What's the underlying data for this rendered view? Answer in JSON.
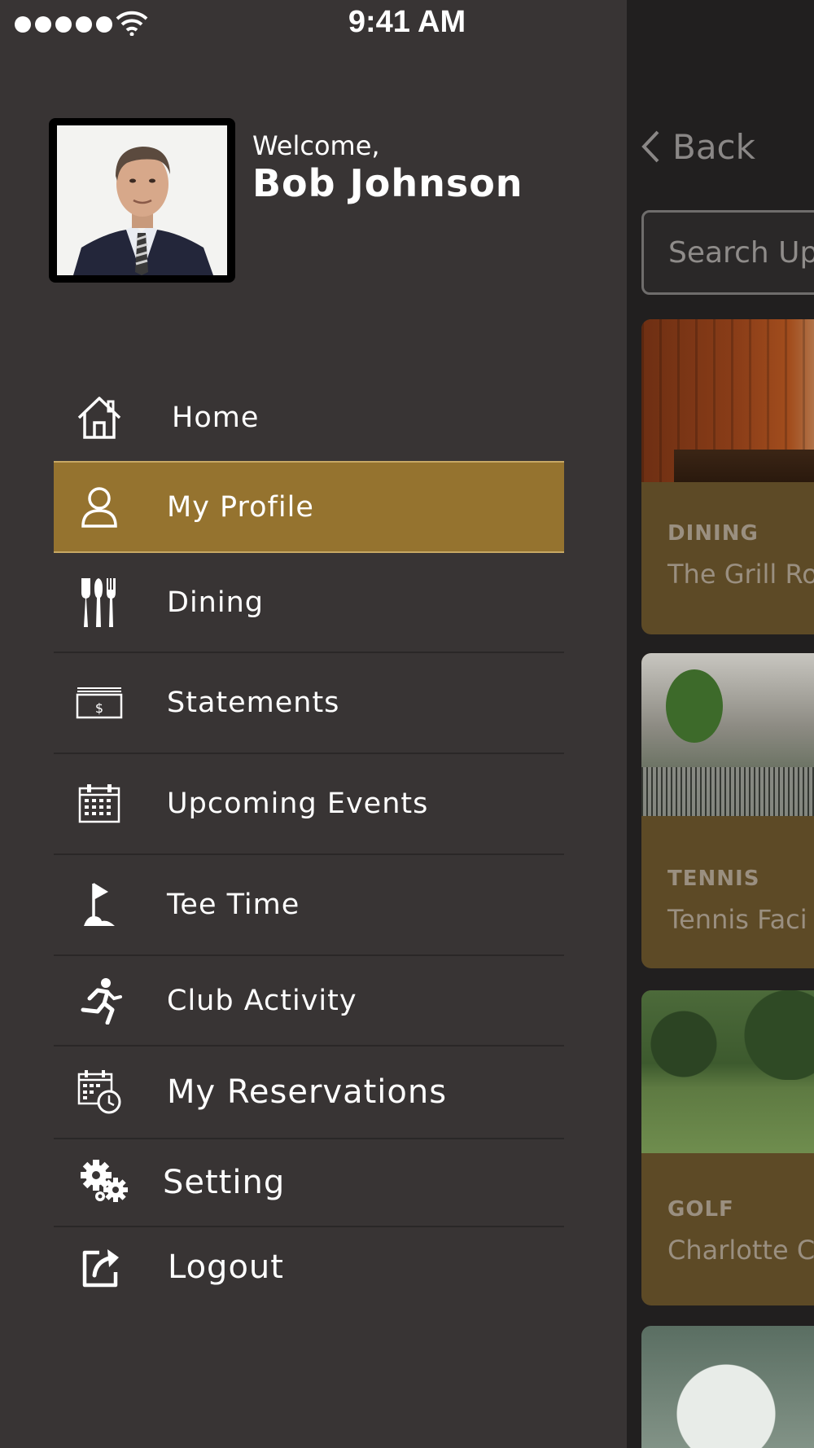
{
  "status_bar": {
    "time": "9:41 AM"
  },
  "background_screen": {
    "back_label": "Back",
    "search_placeholder": "Search Up",
    "cards": [
      {
        "category": "DINING",
        "name": "The Grill Ro"
      },
      {
        "category": "TENNIS",
        "name": "Tennis Faci"
      },
      {
        "category": "GOLF",
        "name": "Charlotte C"
      }
    ]
  },
  "drawer": {
    "welcome": "Welcome,",
    "user_name": "Bob Johnson",
    "menu": [
      {
        "label": "Home",
        "icon": "home-icon"
      },
      {
        "label": "My Profile",
        "icon": "user-icon",
        "active": true
      },
      {
        "label": "Dining",
        "icon": "cutlery-icon"
      },
      {
        "label": "Statements",
        "icon": "statement-icon"
      },
      {
        "label": "Upcoming Events",
        "icon": "calendar-icon"
      },
      {
        "label": "Tee Time",
        "icon": "golf-flag-icon"
      },
      {
        "label": "Club Activity",
        "icon": "running-icon"
      },
      {
        "label": "My Reservations",
        "icon": "calendar-clock-icon"
      },
      {
        "label": "Setting",
        "icon": "gears-icon"
      },
      {
        "label": "Logout",
        "icon": "logout-icon"
      }
    ],
    "colors": {
      "drawer_bg": "#383434",
      "active_bg": "#95732f",
      "card_bg": "#5d4a26"
    }
  }
}
